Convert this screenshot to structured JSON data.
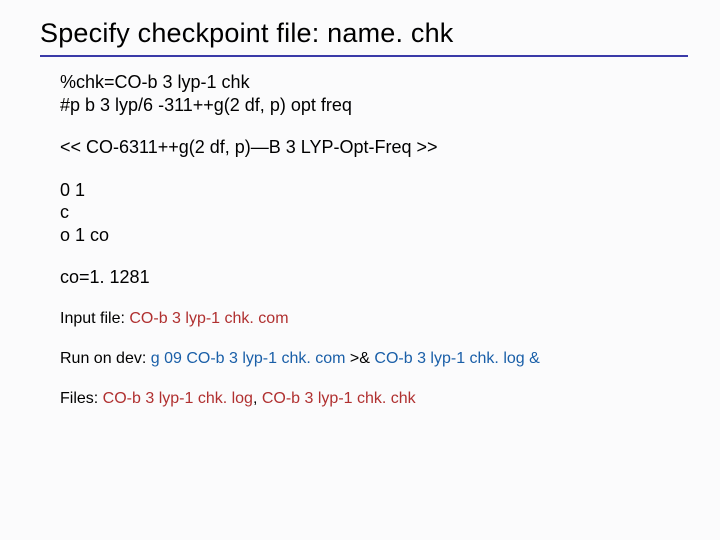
{
  "title": "Specify checkpoint file: name. chk",
  "input": {
    "chk_line": "%chk=CO-b 3 lyp-1 chk",
    "route_line": "#p b 3 lyp/6 -311++g(2 df, p) opt freq",
    "title_card": "<< CO-6311++g(2 df, p)—B 3 LYP-Opt-Freq >>",
    "charge_mult": "0 1",
    "atom1": "c",
    "atom2": "o 1 co",
    "var1": "co=1. 1281"
  },
  "footer": {
    "input_label": "Input file: ",
    "input_file": "CO-b 3 lyp-1 chk. com",
    "run_label": "Run on dev: ",
    "run_cmd_a": "g 09 CO-b 3 lyp-1 chk. com ",
    "run_cmd_amp": ">& ",
    "run_cmd_b": "CO-b 3 lyp-1 chk. log &",
    "files_label": "Files: ",
    "file1": "CO-b 3 lyp-1 chk. log",
    "files_sep": ",  ",
    "file2": "CO-b 3 lyp-1 chk. chk"
  }
}
